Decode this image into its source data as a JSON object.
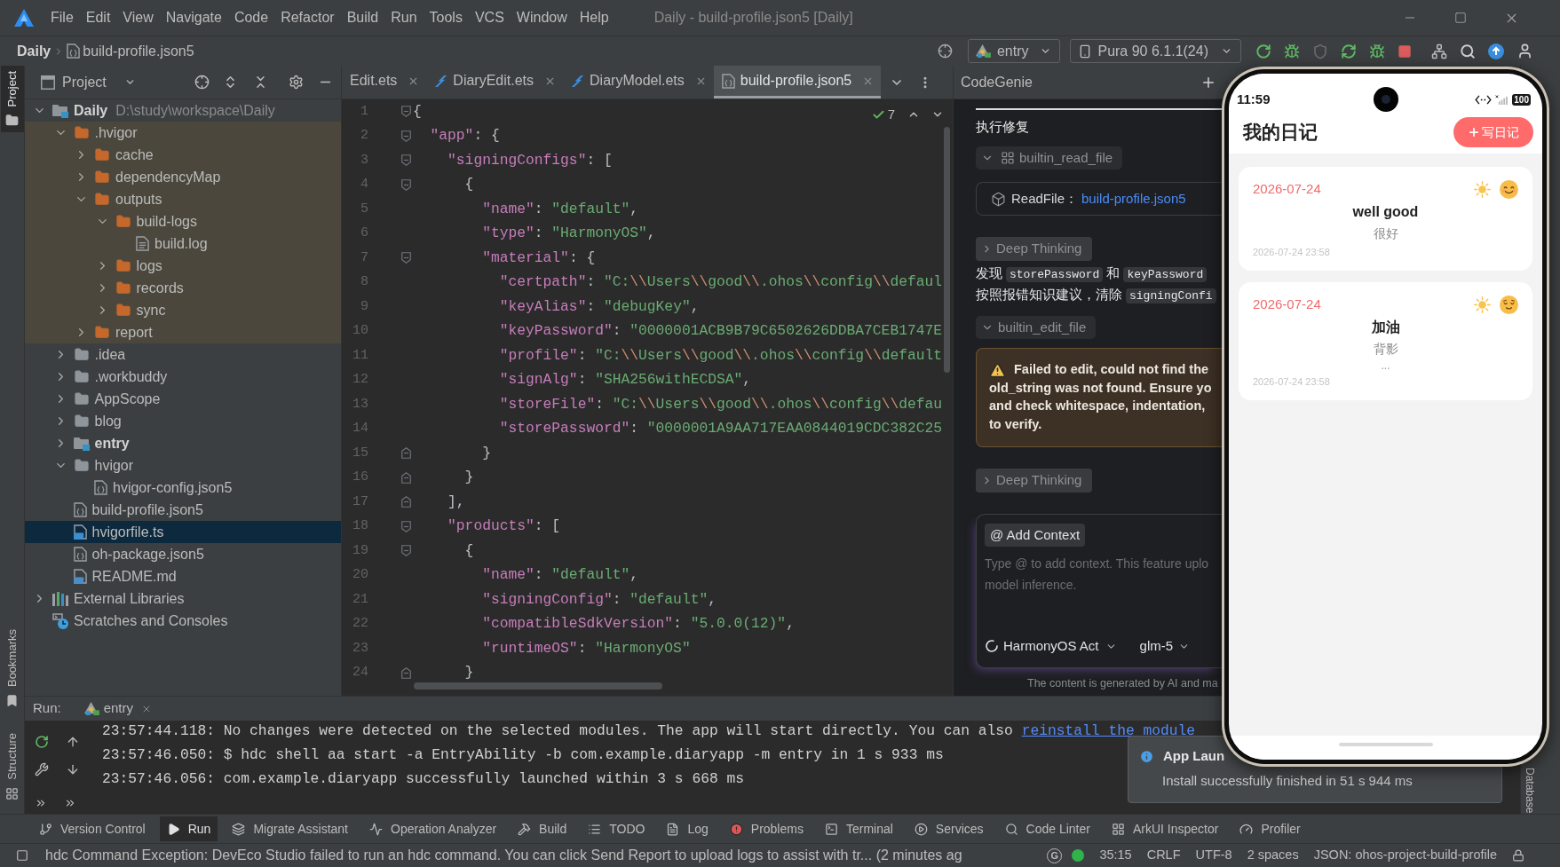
{
  "title_bar": {
    "menus": [
      "File",
      "Edit",
      "View",
      "Navigate",
      "Code",
      "Refactor",
      "Build",
      "Run",
      "Tools",
      "VCS",
      "Window",
      "Help"
    ],
    "title": "Daily - build-profile.json5 [Daily]"
  },
  "nav_bar": {
    "breadcrumb": [
      {
        "label": "Daily",
        "kind": "project"
      },
      {
        "label": "build-profile.json5",
        "kind": "json"
      }
    ],
    "run_config": "entry",
    "device": "Pura 90 6.1.1(24)"
  },
  "left_stripe": {
    "top": [
      {
        "label": "Project",
        "kind": "project",
        "selected": true
      }
    ],
    "bottom": [
      {
        "label": "Bookmarks",
        "kind": "bookmarks",
        "selected": false
      },
      {
        "label": "Structure",
        "kind": "structure",
        "selected": false
      }
    ]
  },
  "right_stripe": [
    "Database"
  ],
  "project_panel": {
    "title": "Project",
    "tree": [
      {
        "label": "Daily",
        "path": "D:\\study\\workspace\\Daily",
        "kind": "module",
        "expanded": true,
        "selected": false,
        "children": [
          {
            "label": ".hvigor",
            "kind": "folder",
            "excluded": true,
            "expanded": true,
            "selected": false,
            "children": [
              {
                "label": "cache",
                "kind": "folder",
                "expanded": false,
                "selected": false
              },
              {
                "label": "dependencyMap",
                "kind": "folder",
                "expanded": false,
                "selected": false
              },
              {
                "label": "outputs",
                "kind": "folder",
                "expanded": true,
                "selected": false,
                "children": [
                  {
                    "label": "build-logs",
                    "kind": "folder",
                    "expanded": true,
                    "selected": false,
                    "children": [
                      {
                        "label": "build.log",
                        "kind": "text",
                        "selected": false
                      }
                    ]
                  },
                  {
                    "label": "logs",
                    "kind": "folder",
                    "expanded": false,
                    "selected": false
                  },
                  {
                    "label": "records",
                    "kind": "folder",
                    "expanded": false,
                    "selected": false
                  },
                  {
                    "label": "sync",
                    "kind": "folder",
                    "expanded": false,
                    "selected": false
                  }
                ]
              },
              {
                "label": "report",
                "kind": "folder",
                "expanded": false,
                "selected": false
              }
            ]
          },
          {
            "label": ".idea",
            "kind": "folder",
            "expanded": false,
            "selected": false
          },
          {
            "label": ".workbuddy",
            "kind": "folder",
            "expanded": false,
            "selected": false
          },
          {
            "label": "AppScope",
            "kind": "folder",
            "expanded": false,
            "selected": false
          },
          {
            "label": "blog",
            "kind": "folder",
            "expanded": false,
            "selected": false
          },
          {
            "label": "entry",
            "kind": "module",
            "expanded": false,
            "selected": false
          },
          {
            "label": "hvigor",
            "kind": "folder",
            "expanded": true,
            "selected": false,
            "children": [
              {
                "label": "hvigor-config.json5",
                "kind": "json",
                "selected": false
              }
            ]
          },
          {
            "label": "build-profile.json5",
            "kind": "json",
            "selected": false
          },
          {
            "label": "hvigorfile.ts",
            "kind": "ts",
            "selected": true
          },
          {
            "label": "oh-package.json5",
            "kind": "json",
            "selected": false
          },
          {
            "label": "README.md",
            "kind": "md",
            "selected": false
          }
        ]
      },
      {
        "label": "External Libraries",
        "kind": "libraries",
        "expanded": false,
        "selected": false
      },
      {
        "label": "Scratches and Consoles",
        "kind": "scratches",
        "selected": false
      }
    ]
  },
  "editor": {
    "tabs": [
      {
        "label": "Edit.ets",
        "selected": false
      },
      {
        "label": "DiaryEdit.ets",
        "kind": "ets",
        "selected": false
      },
      {
        "label": "DiaryModel.ets",
        "kind": "ets",
        "selected": false
      },
      {
        "label": "build-profile.json5",
        "kind": "json",
        "selected": true
      }
    ],
    "inspection_count": "7",
    "lines": [
      {
        "number": "1",
        "code": "{"
      },
      {
        "number": "2",
        "code": "  \"app\": {"
      },
      {
        "number": "3",
        "code": "    \"signingConfigs\": ["
      },
      {
        "number": "4",
        "code": "      {"
      },
      {
        "number": "5",
        "code": "        \"name\": \"default\","
      },
      {
        "number": "6",
        "code": "        \"type\": \"HarmonyOS\","
      },
      {
        "number": "7",
        "code": "        \"material\": {"
      },
      {
        "number": "8",
        "code": "          \"certpath\": \"C:\\\\Users\\\\good\\\\.ohos\\\\config\\\\defaul"
      },
      {
        "number": "9",
        "code": "          \"keyAlias\": \"debugKey\","
      },
      {
        "number": "10",
        "code": "          \"keyPassword\": \"0000001ACB9B79C6502626DDBA7CEB1747E"
      },
      {
        "number": "11",
        "code": "          \"profile\": \"C:\\\\Users\\\\good\\\\.ohos\\\\config\\\\default"
      },
      {
        "number": "12",
        "code": "          \"signAlg\": \"SHA256withECDSA\","
      },
      {
        "number": "13",
        "code": "          \"storeFile\": \"C:\\\\Users\\\\good\\\\.ohos\\\\config\\\\defau"
      },
      {
        "number": "14",
        "code": "          \"storePassword\": \"0000001A9AA717EAA0844019CDC382C25"
      },
      {
        "number": "15",
        "code": "        }"
      },
      {
        "number": "16",
        "code": "      }"
      },
      {
        "number": "17",
        "code": "    ],"
      },
      {
        "number": "18",
        "code": "    \"products\": ["
      },
      {
        "number": "19",
        "code": "      {"
      },
      {
        "number": "20",
        "code": "        \"name\": \"default\","
      },
      {
        "number": "21",
        "code": "        \"signingConfig\": \"default\","
      },
      {
        "number": "22",
        "code": "        \"compatibleSdkVersion\": \"5.0.0(12)\","
      },
      {
        "number": "23",
        "code": "        \"runtimeOS\": \"HarmonyOS\""
      },
      {
        "number": "24",
        "code": "      }"
      }
    ]
  },
  "codegenie": {
    "title": "CodeGenie",
    "heading": "执行修复",
    "items": [
      {
        "kind": "readcall",
        "label": "builtin_read_file",
        "expanded": true
      },
      {
        "kind": "filecard",
        "action": "ReadFile：",
        "file": "build-profile.json5"
      },
      {
        "kind": "thinking",
        "label": "Deep Thinking",
        "expanded": false
      },
      {
        "kind": "message",
        "lines": [
          [
            {
              "text": "发现"
            },
            {
              "code": "storePassword"
            },
            {
              "text": "和"
            },
            {
              "code": "keyPassword"
            }
          ],
          [
            {
              "text": "按照报错知识建议，清除"
            },
            {
              "code": "signingConfi"
            }
          ]
        ]
      },
      {
        "kind": "editcall",
        "label": "builtin_edit_file",
        "expanded": true
      },
      {
        "kind": "warning",
        "lines": [
          "Failed to edit, could not find the",
          "old_string was not found. Ensure yo",
          "and check whitespace, indentation,",
          "to verify."
        ]
      },
      {
        "kind": "thinking",
        "label": "Deep Thinking",
        "expanded": false
      }
    ],
    "input": {
      "add_context": "@ Add Context",
      "placeholder": "Type @ to add context. This feature uplo\nmodel inference.",
      "mode": "HarmonyOS Act",
      "model": "glm-5"
    },
    "disclaimer": "The content is generated by AI and ma"
  },
  "run_panel": {
    "label": "Run:",
    "tab": "entry",
    "lines": [
      {
        "text": "23:57:44.118: No changes were detected on the selected modules. The app will start directly. You can also",
        "link": "reinstall the module"
      },
      {
        "text": "23:57:46.050: $ hdc shell aa start -a EntryAbility -b com.example.diaryapp -m entry in 1 s 933 ms"
      },
      {
        "text": "23:57:46.056: com.example.diaryapp successfully launched within 3 s 668 ms"
      }
    ]
  },
  "toast": {
    "title": "App Laun",
    "message": "Install successfully finished in 51 s 944 ms"
  },
  "tool_windows": [
    {
      "label": "Version Control",
      "kind": "vcs",
      "selected": false
    },
    {
      "label": "Run",
      "kind": "run",
      "selected": true
    },
    {
      "label": "Migrate Assistant",
      "kind": "migrate",
      "selected": false
    },
    {
      "label": "Operation Analyzer",
      "kind": "analyzer",
      "selected": false
    },
    {
      "label": "Build",
      "kind": "build",
      "selected": false
    },
    {
      "label": "TODO",
      "kind": "todo",
      "selected": false
    },
    {
      "label": "Log",
      "kind": "log",
      "selected": false
    },
    {
      "label": "Problems",
      "kind": "problems",
      "selected": false
    },
    {
      "label": "Terminal",
      "kind": "terminal",
      "selected": false
    },
    {
      "label": "Services",
      "kind": "services",
      "selected": false
    },
    {
      "label": "Code Linter",
      "kind": "linter",
      "selected": false
    },
    {
      "label": "ArkUI Inspector",
      "kind": "inspector",
      "selected": false
    },
    {
      "label": "Profiler",
      "kind": "profiler",
      "selected": false
    }
  ],
  "status_bar": {
    "message": "hdc Command Exception: DevEco Studio failed to run an hdc command. You can click Send Report to upload logs to assist with tr... (2 minutes ag",
    "badge": "G",
    "items": [
      "35:15",
      "CRLF",
      "UTF-8",
      "2 spaces",
      "JSON: ohos-project-build-profile"
    ]
  },
  "phone": {
    "time": "11:59",
    "battery": "100",
    "app_title": "我的日记",
    "new_button": "写日记",
    "entries": [
      {
        "date": "2026-07-24",
        "weather": {
          "kind": "sunny"
        },
        "mood": {
          "kind": "happy"
        },
        "title": "well good",
        "content": "很好",
        "timestamp": "2026-07-24 23:58"
      },
      {
        "date": "2026-07-24",
        "weather": {
          "kind": "sunny"
        },
        "mood": {
          "kind": "calm"
        },
        "title": "加油",
        "content": "背影",
        "more": "...",
        "timestamp": "2026-07-24 23:58"
      }
    ]
  }
}
